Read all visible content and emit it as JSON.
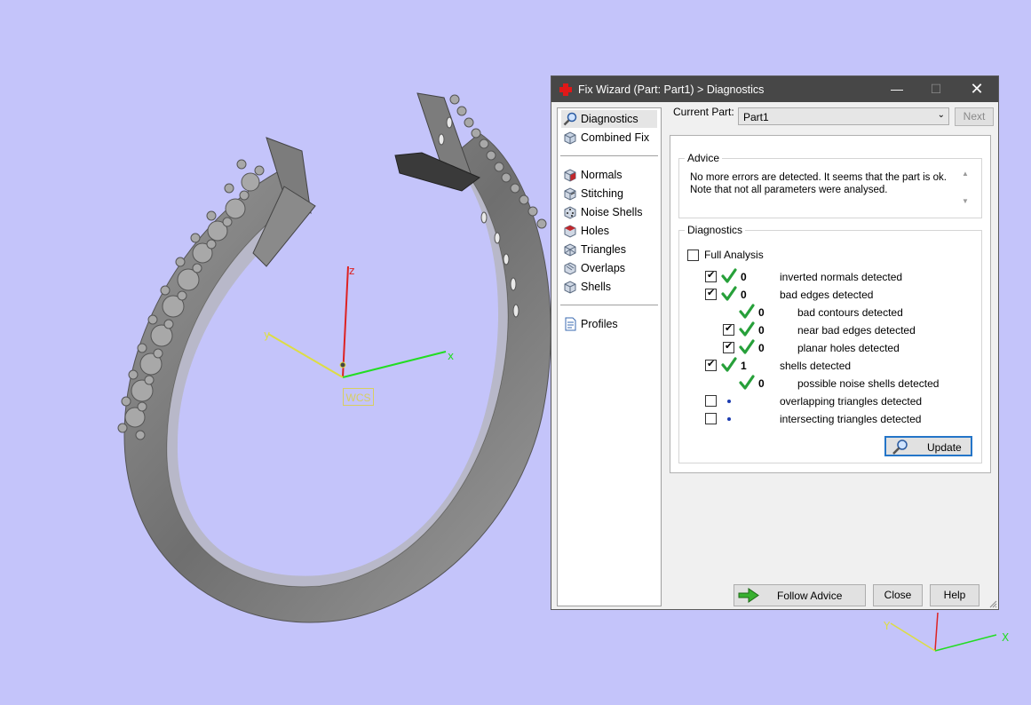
{
  "viewport": {
    "axis_labels": {
      "x": "x",
      "y": "y",
      "z": "z"
    },
    "wcs_label": "WCS",
    "corner_axis_labels": {
      "x": "X",
      "y": "Y"
    },
    "colors": {
      "background": "#c4c4fa",
      "model": "#8a8a8a",
      "x_axis": "#22dd22",
      "y_axis": "#dddd44",
      "z_axis": "#dd2222"
    }
  },
  "dialog": {
    "title": "Fix Wizard (Part: Part1) > Diagnostics",
    "title_icon": "red-cross-icon",
    "window_buttons": {
      "minimize": "—",
      "maximize": "☐",
      "close": "✕"
    },
    "sidebar": {
      "top_items": [
        {
          "label": "Diagnostics",
          "icon": "magnifier-icon",
          "selected": true
        },
        {
          "label": "Combined Fix",
          "icon": "cube-icon"
        }
      ],
      "fix_items": [
        {
          "label": "Normals",
          "icon": "normals-cube-icon"
        },
        {
          "label": "Stitching",
          "icon": "stitching-cube-icon"
        },
        {
          "label": "Noise Shells",
          "icon": "noise-cube-icon"
        },
        {
          "label": "Holes",
          "icon": "holes-cube-icon"
        },
        {
          "label": "Triangles",
          "icon": "triangles-cube-icon"
        },
        {
          "label": "Overlaps",
          "icon": "overlaps-cube-icon"
        },
        {
          "label": "Shells",
          "icon": "shells-cube-icon"
        }
      ],
      "bottom_items": [
        {
          "label": "Profiles",
          "icon": "profile-document-icon"
        }
      ]
    },
    "current_part_label": "Current Part:",
    "current_part_value": "Part1",
    "next_label": "Next",
    "advice": {
      "title": "Advice",
      "line1": "No more errors are detected. It seems that the part is ok.",
      "line2": "Note that not all parameters were analysed."
    },
    "diagnostics": {
      "title": "Diagnostics",
      "full_analysis_label": "Full Analysis",
      "full_analysis_checked": false,
      "rows": [
        {
          "label": "inverted normals detected",
          "count": "0",
          "checked": true,
          "has_checkbox": true,
          "status": "ok",
          "indent": 0
        },
        {
          "label": "bad edges detected",
          "count": "0",
          "checked": true,
          "has_checkbox": true,
          "status": "ok",
          "indent": 0
        },
        {
          "label": "bad contours detected",
          "count": "0",
          "checked": false,
          "has_checkbox": false,
          "status": "ok",
          "indent": 1
        },
        {
          "label": "near bad edges detected",
          "count": "0",
          "checked": true,
          "has_checkbox": true,
          "status": "ok",
          "indent": 1
        },
        {
          "label": "planar holes detected",
          "count": "0",
          "checked": true,
          "has_checkbox": true,
          "status": "ok",
          "indent": 1
        },
        {
          "label": "shells detected",
          "count": "1",
          "checked": true,
          "has_checkbox": true,
          "status": "ok",
          "indent": 0
        },
        {
          "label": "possible noise shells detected",
          "count": "0",
          "checked": false,
          "has_checkbox": false,
          "status": "ok",
          "indent": 1
        },
        {
          "label": "overlapping triangles detected",
          "count": "",
          "checked": false,
          "has_checkbox": true,
          "status": "pending",
          "indent": 0
        },
        {
          "label": "intersecting triangles detected",
          "count": "",
          "checked": false,
          "has_checkbox": true,
          "status": "pending",
          "indent": 0
        }
      ],
      "update_label": "Update"
    },
    "follow_advice_label": "Follow Advice",
    "close_label": "Close",
    "help_label": "Help"
  }
}
